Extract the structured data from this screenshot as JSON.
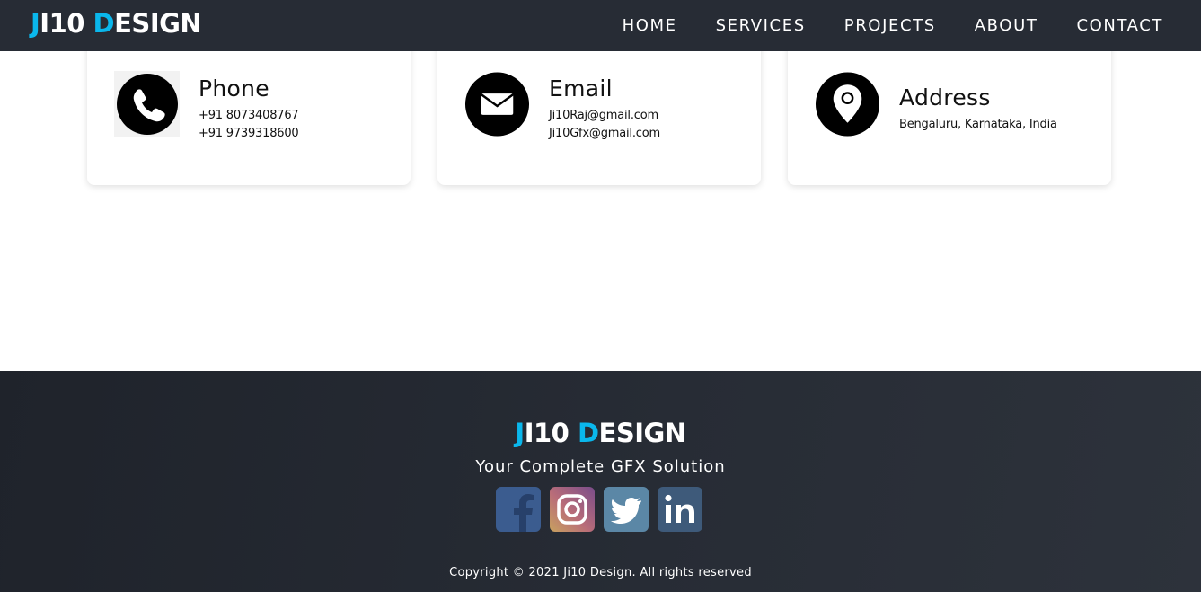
{
  "nav": {
    "logo_part1": "J",
    "logo_part2": "I10 ",
    "logo_part3": "D",
    "logo_part4": "ESIGN",
    "links": [
      "HOME",
      "SERVICES",
      "PROJECTS",
      "ABOUT",
      "CONTACT"
    ]
  },
  "contact_cards": {
    "phone": {
      "title": "Phone",
      "lines": [
        "+91 8073408767",
        "+91 9739318600"
      ],
      "icon": "phone-icon"
    },
    "email": {
      "title": "Email",
      "lines": [
        "Ji10Raj@gmail.com",
        "Ji10Gfx@gmail.com"
      ],
      "icon": "envelope-icon"
    },
    "address": {
      "title": "Address",
      "lines": [
        "Bengaluru, Karnataka, India"
      ],
      "icon": "map-pin-icon"
    }
  },
  "footer": {
    "logo_part1": "J",
    "logo_part2": "I10 ",
    "logo_part3": "D",
    "logo_part4": "ESIGN",
    "tagline": "Your Complete GFX Solution",
    "socials": [
      "facebook",
      "instagram",
      "twitter",
      "linkedin"
    ],
    "copyright": "Copyright © 2021 Ji10 Design. All rights reserved"
  },
  "colors": {
    "accent": "#0ab7ec",
    "navbar": "#272c35",
    "footer": "#22262e"
  }
}
